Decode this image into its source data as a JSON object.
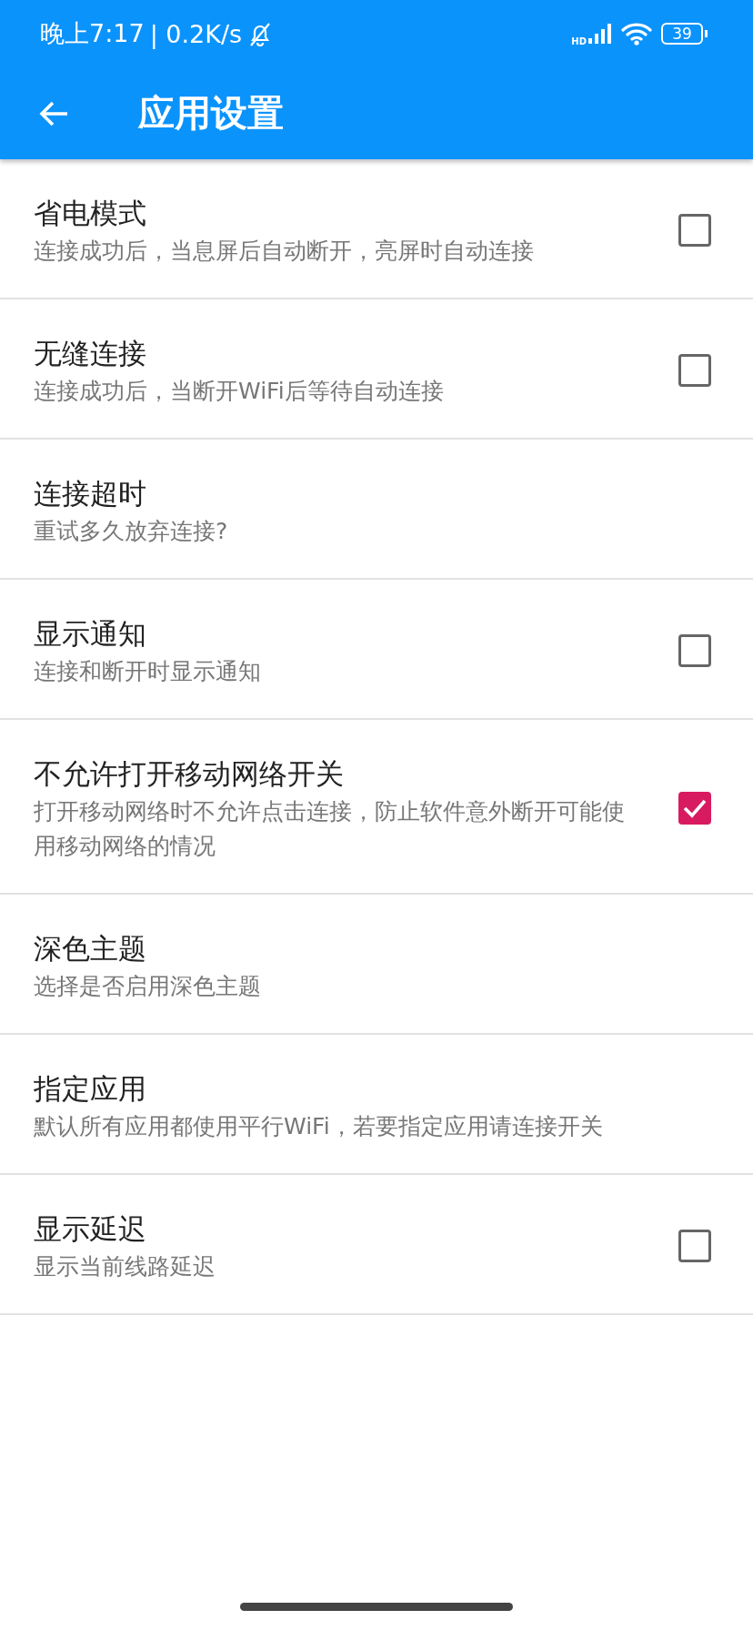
{
  "status_bar": {
    "time": "晚上7:17",
    "speed": "| 0.2K/s",
    "network_label": "HD",
    "battery": "39"
  },
  "app_bar": {
    "title": "应用设置"
  },
  "settings": [
    {
      "kind": "checkbox",
      "title": "省电模式",
      "summary": "连接成功后，当息屏后自动断开，亮屏时自动连接",
      "checked": false
    },
    {
      "kind": "checkbox",
      "title": "无缝连接",
      "summary": "连接成功后，当断开WiFi后等待自动连接",
      "checked": false
    },
    {
      "kind": "plain",
      "title": "连接超时",
      "summary": "重试多久放弃连接?"
    },
    {
      "kind": "checkbox",
      "title": "显示通知",
      "summary": "连接和断开时显示通知",
      "checked": false
    },
    {
      "kind": "checkbox",
      "title": "不允许打开移动网络开关",
      "summary": "打开移动网络时不允许点击连接，防止软件意外断开可能使用移动网络的情况",
      "checked": true
    },
    {
      "kind": "plain",
      "title": "深色主题",
      "summary": "选择是否启用深色主题"
    },
    {
      "kind": "plain",
      "title": "指定应用",
      "summary": "默认所有应用都使用平行WiFi，若要指定应用请连接开关"
    },
    {
      "kind": "checkbox",
      "title": "显示延迟",
      "summary": "显示当前线路延迟",
      "checked": false
    }
  ]
}
